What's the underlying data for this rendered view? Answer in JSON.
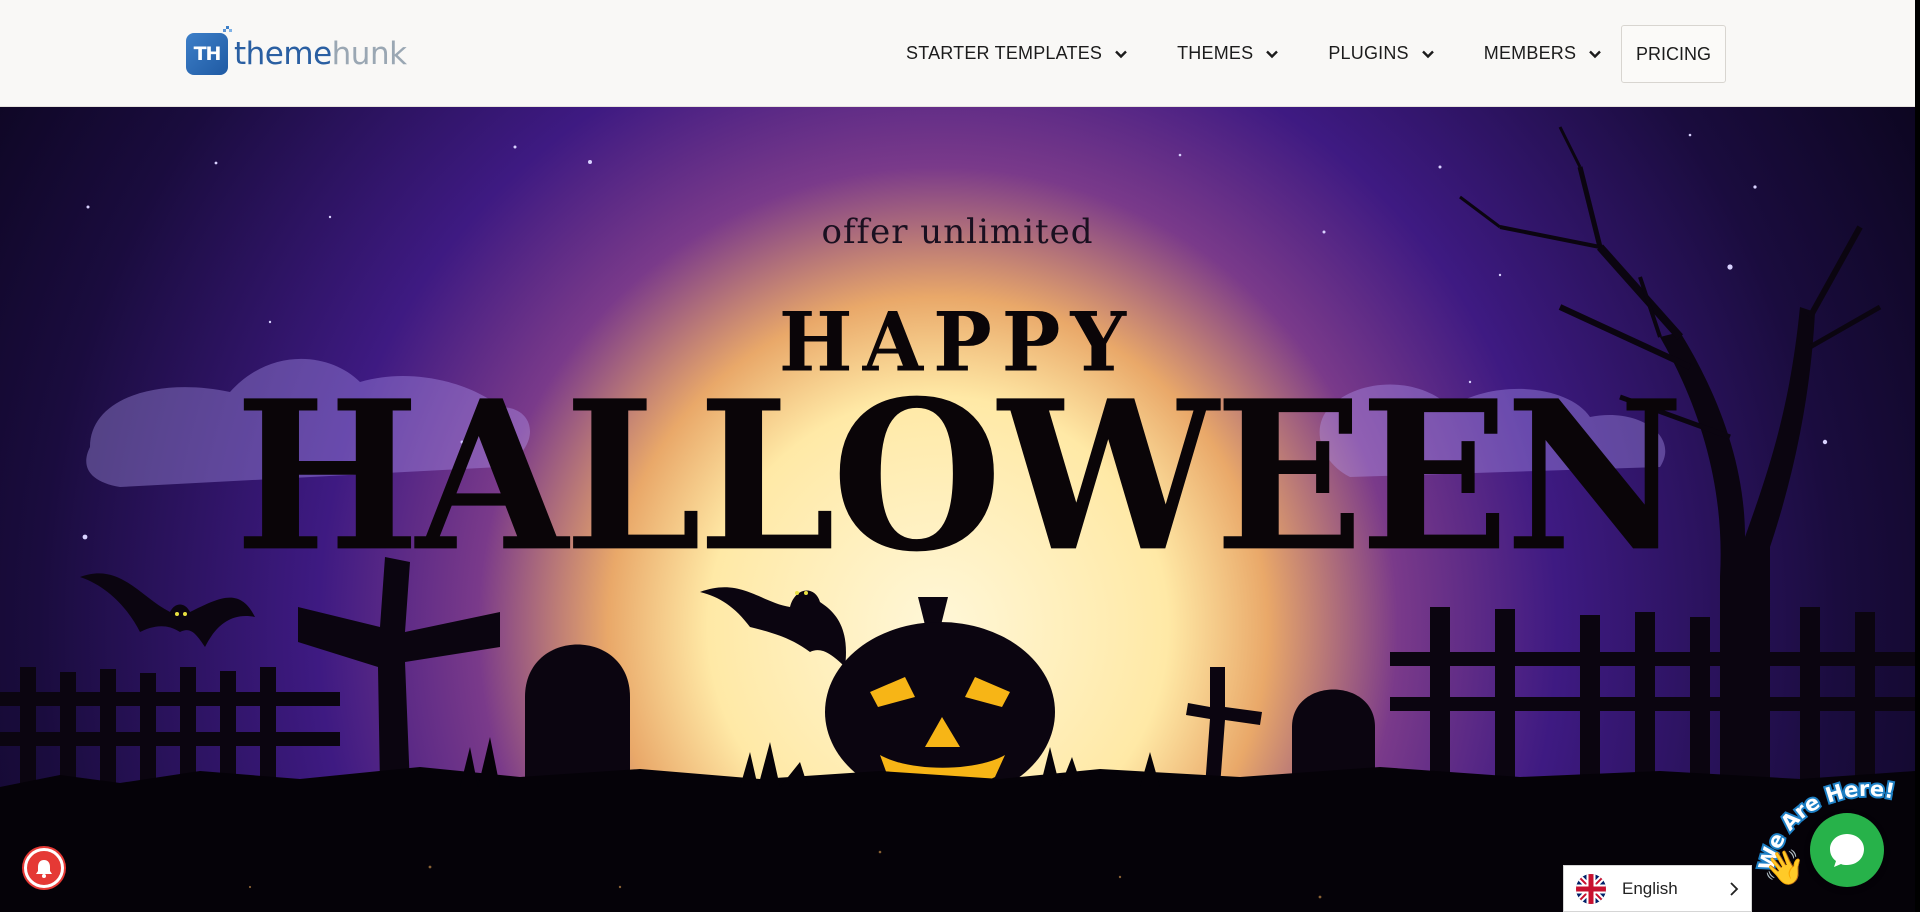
{
  "header": {
    "logo": {
      "icon_text": "TH",
      "text_a": "theme",
      "text_b": "hunk"
    },
    "nav": [
      {
        "label": "STARTER TEMPLATES",
        "icon": "chevron-down-icon"
      },
      {
        "label": "THEMES",
        "icon": "chevron-down-icon"
      },
      {
        "label": "PLUGINS",
        "icon": "chevron-down-icon"
      },
      {
        "label": "MEMBERS",
        "icon": "chevron-down-icon"
      }
    ],
    "pricing_label": "PRICING"
  },
  "hero": {
    "offer_text": "offer unlimited",
    "happy_text": "HAPPY",
    "halloween_text": "HALLOWEEN"
  },
  "widgets": {
    "language": {
      "label": "English",
      "flag_icon": "uk-flag-icon"
    },
    "chat": {
      "badge_text": "We Are Here!",
      "icon": "chat-bubble-icon",
      "color": "#27b24a"
    },
    "notification": {
      "icon": "bell-icon",
      "color": "#e53935"
    }
  }
}
